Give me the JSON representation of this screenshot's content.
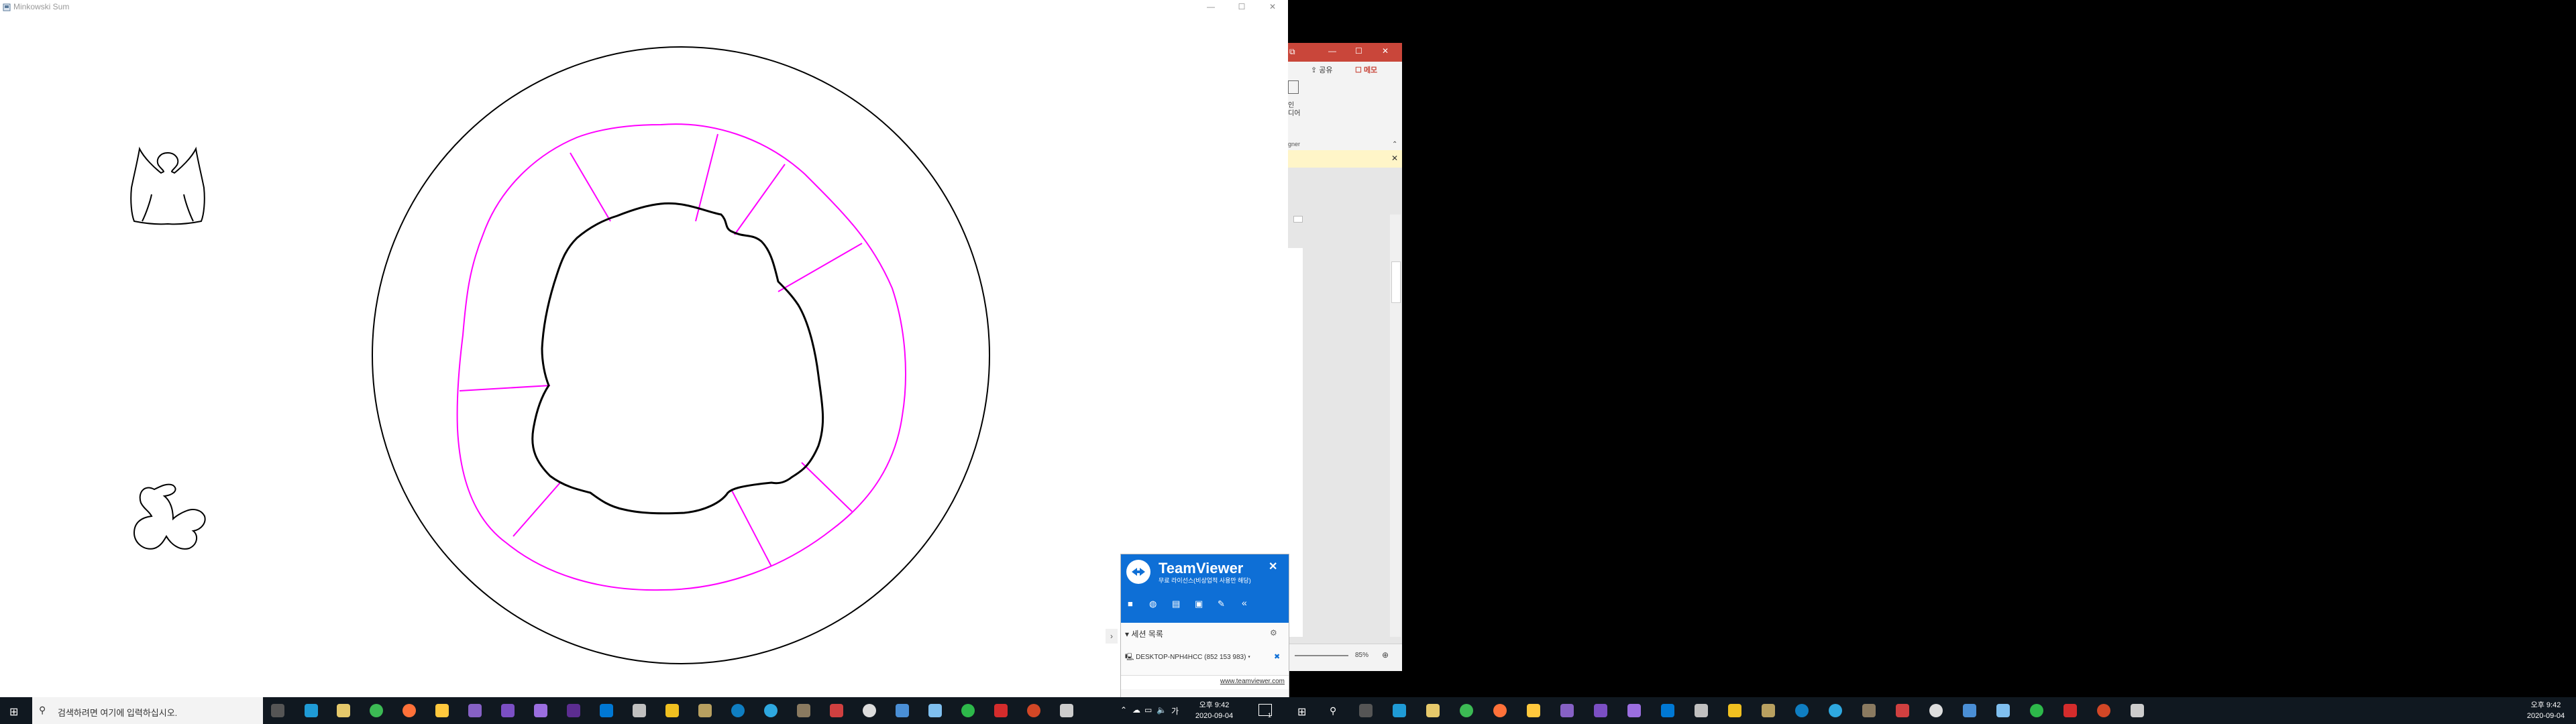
{
  "minkowski": {
    "title": "Minkowski Sum",
    "controls": {
      "minimize": "—",
      "maximize": "☐",
      "close": "✕"
    }
  },
  "powerpoint": {
    "controls": {
      "restore": "⧉",
      "minimize": "—",
      "maximize": "☐",
      "close": "✕"
    },
    "share_label": "공유",
    "memo_label": "메모",
    "ribbon_fragment_1": "인",
    "ribbon_fragment_2": "디어",
    "ribbon_fragment_3": "gner",
    "zoom_label": "85%"
  },
  "teamviewer": {
    "brand": "TeamViewer",
    "license_text": "무료 라이선스(비상업적 사용만 해당)",
    "sessions_header": "세션 목록",
    "device_label": "DESKTOP-NPH4HCC (852 153 983)",
    "website": "www.teamviewer.com"
  },
  "taskbar_left": {
    "search_placeholder": "검색하려면 여기에 입력하십시오.",
    "time": "오후 9:42",
    "date": "2020-09-04",
    "notification_count": "1"
  },
  "taskbar_right": {
    "time": "오후 9:42",
    "date": "2020-09-04"
  },
  "colors": {
    "taskbar": "#101820",
    "tv_blue": "#0e6fd6",
    "ppt_red": "#c9463a",
    "magenta": "#ff00ff",
    "notice_yellow": "#fff5c8"
  }
}
